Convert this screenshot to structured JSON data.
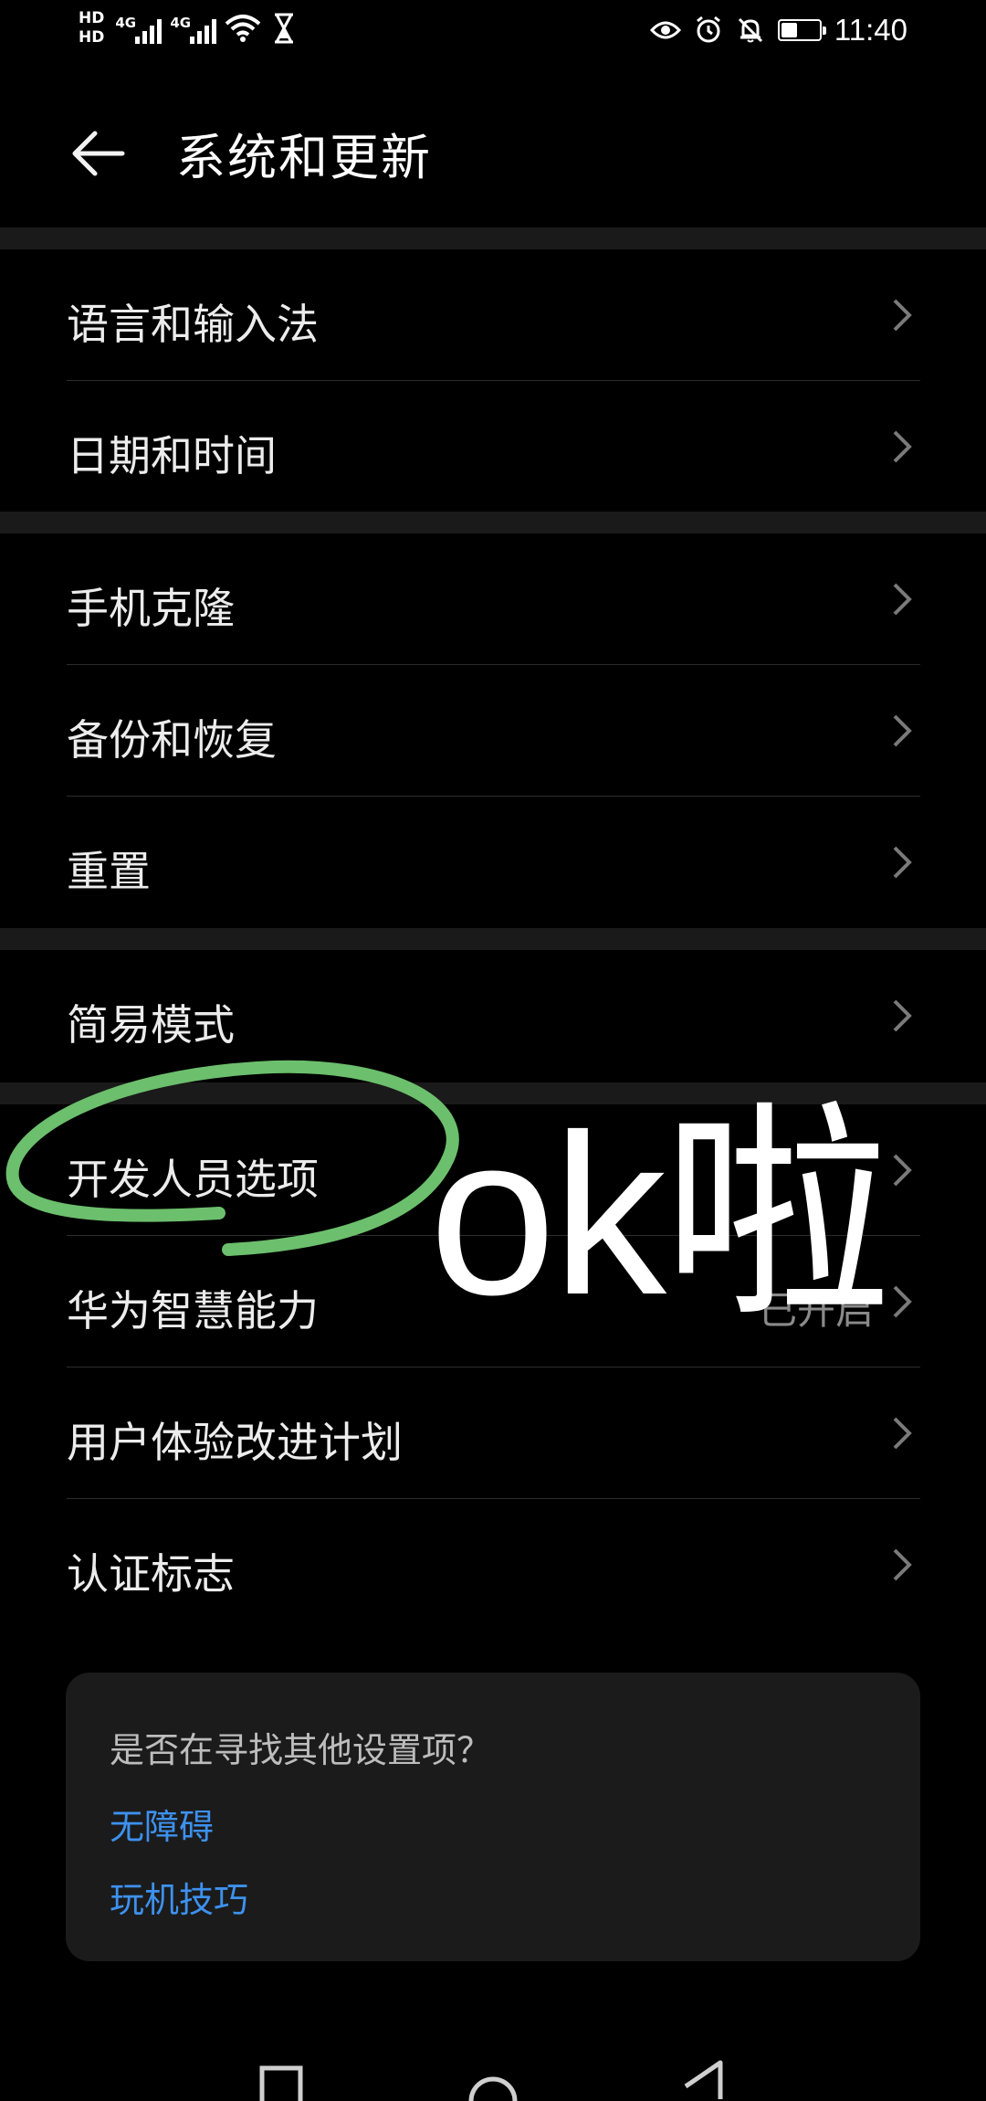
{
  "status_bar": {
    "hd1": "HD",
    "hd2": "HD",
    "net1": "4G",
    "net2": "4G",
    "time": "11:40",
    "icons": [
      "hd-icon",
      "signal-icon",
      "wifi-icon",
      "hourglass-icon",
      "eye-icon",
      "alarm-icon",
      "bell-off-icon",
      "battery-icon"
    ]
  },
  "header": {
    "title": "系统和更新",
    "back_icon": "arrow-left-icon"
  },
  "groups": [
    {
      "items": [
        {
          "label": "语言和输入法"
        },
        {
          "label": "日期和时间"
        }
      ]
    },
    {
      "items": [
        {
          "label": "手机克隆"
        },
        {
          "label": "备份和恢复"
        },
        {
          "label": "重置"
        }
      ]
    },
    {
      "items": [
        {
          "label": "简易模式"
        }
      ]
    },
    {
      "items": [
        {
          "label": "开发人员选项"
        },
        {
          "label": "华为智慧能力",
          "value": "已开启"
        },
        {
          "label": "用户体验改进计划"
        },
        {
          "label": "认证标志"
        }
      ]
    }
  ],
  "card": {
    "question": "是否在寻找其他设置项？",
    "links": [
      "无障碍",
      "玩机技巧"
    ]
  },
  "annotation": {
    "text": "ok啦",
    "circle_color": "#6cbf6c"
  },
  "colors": {
    "background": "#000000",
    "link": "#3d91ef",
    "band": "#1a1a1a"
  }
}
